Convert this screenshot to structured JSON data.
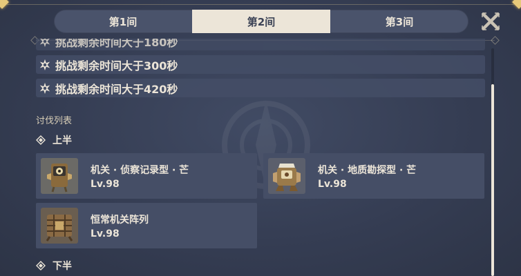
{
  "tabs": [
    {
      "label": "第1间",
      "active": false
    },
    {
      "label": "第2间",
      "active": true
    },
    {
      "label": "第3间",
      "active": false
    }
  ],
  "conditions": [
    {
      "label": "挑战剩余时间大于180秒"
    },
    {
      "label": "挑战剩余时间大于300秒"
    },
    {
      "label": "挑战剩余时间大于420秒"
    }
  ],
  "list_title": "讨伐列表",
  "first_half": {
    "label": "上半",
    "enemies": [
      {
        "name": "机关 · 侦察记录型 · 芒",
        "level": "Lv.98",
        "icon": "reconnaissance-automaton-icon"
      },
      {
        "name": "机关 · 地质勘探型 · 芒",
        "level": "Lv.98",
        "icon": "geological-survey-automaton-icon"
      },
      {
        "name": "恒常机关阵列",
        "level": "Lv.98",
        "icon": "perpetual-mechanical-array-icon"
      }
    ]
  },
  "second_half": {
    "label": "下半"
  },
  "colors": {
    "accent_cream": "#ece5d8",
    "panel_bg": "#353d53",
    "card_bg": "#454e66"
  }
}
